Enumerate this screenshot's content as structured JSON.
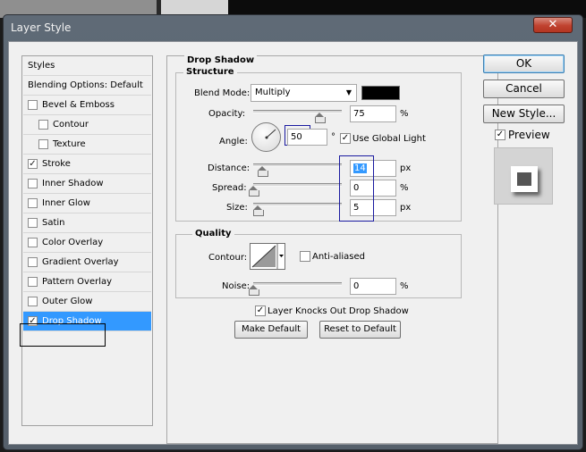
{
  "window": {
    "title": "Layer Style",
    "close_glyph": "✕"
  },
  "sidebar": {
    "header": "Styles",
    "blending": "Blending Options: Default",
    "items": [
      {
        "label": "Bevel & Emboss",
        "checked": false,
        "sub": false
      },
      {
        "label": "Contour",
        "checked": false,
        "sub": true
      },
      {
        "label": "Texture",
        "checked": false,
        "sub": true
      },
      {
        "label": "Stroke",
        "checked": true,
        "sub": false
      },
      {
        "label": "Inner Shadow",
        "checked": false,
        "sub": false
      },
      {
        "label": "Inner Glow",
        "checked": false,
        "sub": false
      },
      {
        "label": "Satin",
        "checked": false,
        "sub": false
      },
      {
        "label": "Color Overlay",
        "checked": false,
        "sub": false
      },
      {
        "label": "Gradient Overlay",
        "checked": false,
        "sub": false
      },
      {
        "label": "Pattern Overlay",
        "checked": false,
        "sub": false
      },
      {
        "label": "Outer Glow",
        "checked": false,
        "sub": false
      },
      {
        "label": "Drop Shadow",
        "checked": true,
        "sub": false,
        "selected": true
      }
    ],
    "check_glyph": "✓"
  },
  "drop_shadow": {
    "title": "Drop Shadow",
    "structure": {
      "title": "Structure",
      "blend_mode_label": "Blend Mode:",
      "blend_mode_value": "Multiply",
      "blend_color": "#000000",
      "opacity_label": "Opacity:",
      "opacity_value": "75",
      "opacity_level": 0.75,
      "opacity_unit": "%",
      "angle_label": "Angle:",
      "angle_value": "50",
      "angle_unit": "°",
      "use_global_light_label": "Use Global Light",
      "use_global_light_checked": true,
      "distance_label": "Distance:",
      "distance_value": "14",
      "distance_level": 0.1,
      "distance_unit": "px",
      "spread_label": "Spread:",
      "spread_value": "0",
      "spread_level": 0,
      "spread_unit": "%",
      "size_label": "Size:",
      "size_value": "5",
      "size_level": 0.05,
      "size_unit": "px"
    },
    "quality": {
      "title": "Quality",
      "contour_label": "Contour:",
      "anti_aliased_label": "Anti-aliased",
      "anti_aliased_checked": false,
      "noise_label": "Noise:",
      "noise_value": "0",
      "noise_level": 0,
      "noise_unit": "%"
    },
    "knockout_label": "Layer Knocks Out Drop Shadow",
    "knockout_checked": true,
    "make_default_label": "Make Default",
    "reset_default_label": "Reset to Default"
  },
  "buttons": {
    "ok": "OK",
    "cancel": "Cancel",
    "new_style": "New Style...",
    "preview_label": "Preview",
    "preview_checked": true
  },
  "colors": {
    "selection": "#3399ff",
    "accent_outline": "#1a1aa0"
  }
}
